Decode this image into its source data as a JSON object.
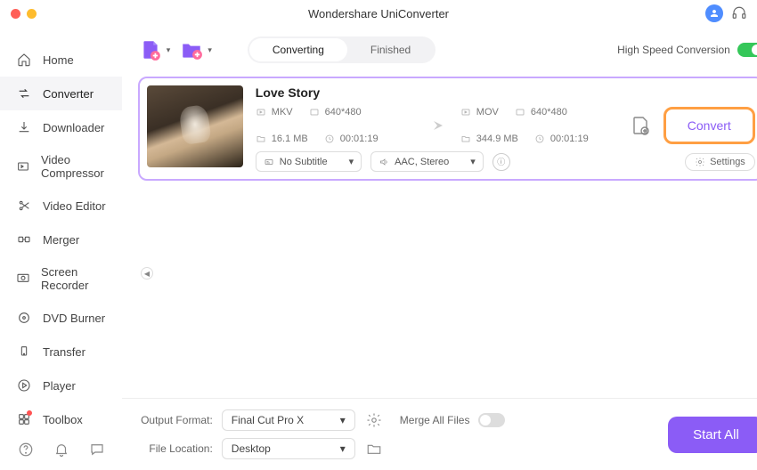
{
  "app_title": "Wondershare UniConverter",
  "sidebar": {
    "items": [
      {
        "label": "Home"
      },
      {
        "label": "Converter"
      },
      {
        "label": "Downloader"
      },
      {
        "label": "Video Compressor"
      },
      {
        "label": "Video Editor"
      },
      {
        "label": "Merger"
      },
      {
        "label": "Screen Recorder"
      },
      {
        "label": "DVD Burner"
      },
      {
        "label": "Transfer"
      },
      {
        "label": "Player"
      },
      {
        "label": "Toolbox"
      }
    ]
  },
  "segment": {
    "converting": "Converting",
    "finished": "Finished"
  },
  "hsc_label": "High Speed Conversion",
  "file": {
    "title": "Love Story",
    "src": {
      "format": "MKV",
      "resolution": "640*480",
      "size": "16.1 MB",
      "duration": "00:01:19"
    },
    "dst": {
      "format": "MOV",
      "resolution": "640*480",
      "size": "344.9 MB",
      "duration": "00:01:19"
    },
    "subtitle": "No Subtitle",
    "audio": "AAC, Stereo",
    "settings_label": "Settings",
    "convert_label": "Convert"
  },
  "bottom": {
    "output_format_label": "Output Format:",
    "output_format_value": "Final Cut Pro X",
    "file_location_label": "File Location:",
    "file_location_value": "Desktop",
    "merge_label": "Merge All Files",
    "start_all_label": "Start All"
  }
}
